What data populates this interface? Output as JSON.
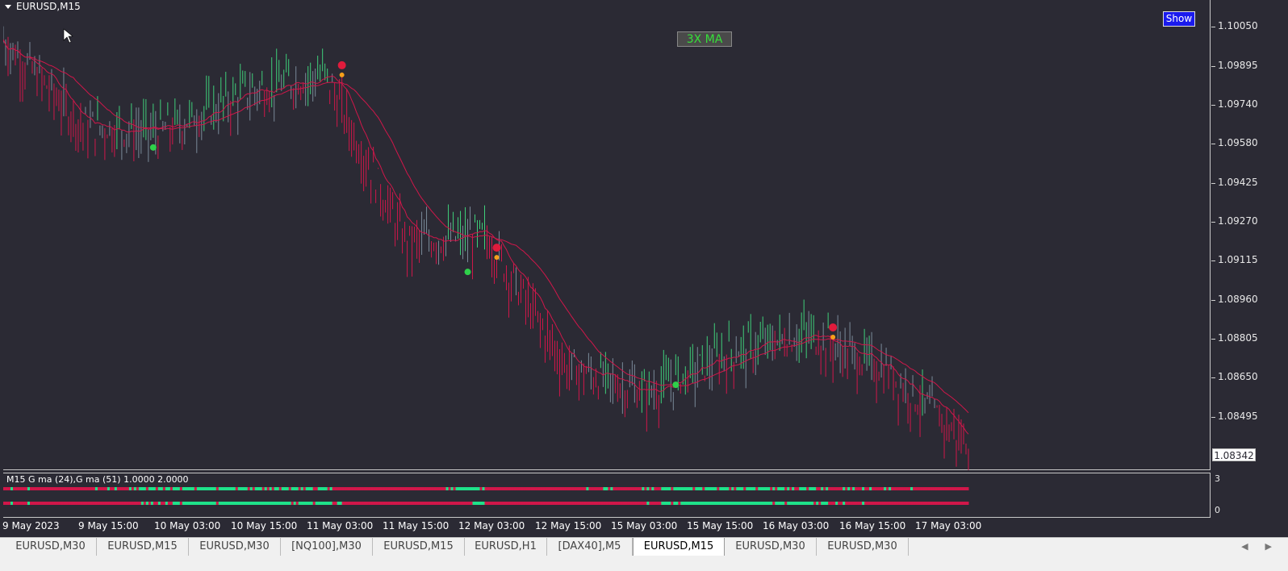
{
  "window": {
    "title": "EURUSD,M15"
  },
  "overlay": {
    "ma_label": "3X MA",
    "show_button": "Show"
  },
  "price_axis": {
    "ticks": [
      "1.10050",
      "1.09895",
      "1.09740",
      "1.09580",
      "1.09425",
      "1.09270",
      "1.09115",
      "1.08960",
      "1.08805",
      "1.08650",
      "1.08495"
    ],
    "current_price": "1.08342"
  },
  "subwindow": {
    "label": "M15 G ma (24),G ma (51) 1.0000 2.0000",
    "axis_top": "3",
    "axis_bottom": "0"
  },
  "time_axis": {
    "labels": [
      "9 May 2023",
      "9 May 15:00",
      "10 May 03:00",
      "10 May 15:00",
      "11 May 03:00",
      "11 May 15:00",
      "12 May 03:00",
      "12 May 15:00",
      "15 May 03:00",
      "15 May 15:00",
      "16 May 03:00",
      "16 May 15:00",
      "17 May 03:00"
    ]
  },
  "tabs": [
    {
      "label": "EURUSD,M30",
      "active": false
    },
    {
      "label": "EURUSD,M15",
      "active": false
    },
    {
      "label": "EURUSD,M30",
      "active": false
    },
    {
      "label": "[NQ100],M30",
      "active": false
    },
    {
      "label": "EURUSD,M15",
      "active": false
    },
    {
      "label": "EURUSD,H1",
      "active": false
    },
    {
      "label": "[DAX40],M5",
      "active": false
    },
    {
      "label": "EURUSD,M15",
      "active": true
    },
    {
      "label": "EURUSD,M30",
      "active": false
    },
    {
      "label": "EURUSD,M30",
      "active": false
    }
  ],
  "colors": {
    "background": "#2b2a34",
    "bear": "#d0174a",
    "bull": "#3fcf7a",
    "neutral": "#7a8a99",
    "strip_green": "#1fe28a",
    "strip_red": "#d0174a",
    "buy_signal": "#2fd04a",
    "sell_signal": "#e01b3c",
    "dot_orange": "#f5a01a"
  },
  "chart_data": {
    "type": "line",
    "symbol": "EURUSD",
    "timeframe": "M15",
    "ylim": [
      1.083,
      1.101
    ],
    "x": [
      "9 May 2023",
      "9 May 15:00",
      "10 May 03:00",
      "10 May 15:00",
      "11 May 03:00",
      "11 May 15:00",
      "12 May 03:00",
      "12 May 15:00",
      "15 May 03:00",
      "15 May 15:00",
      "16 May 03:00",
      "16 May 15:00",
      "17 May 03:00"
    ],
    "series": [
      {
        "values": [
          1.0995,
          1.0962,
          1.096,
          1.0975,
          1.0982,
          1.0918,
          1.092,
          1.087,
          1.086,
          1.0875,
          1.0883,
          1.0868,
          1.084
        ]
      }
    ],
    "grid": false
  }
}
